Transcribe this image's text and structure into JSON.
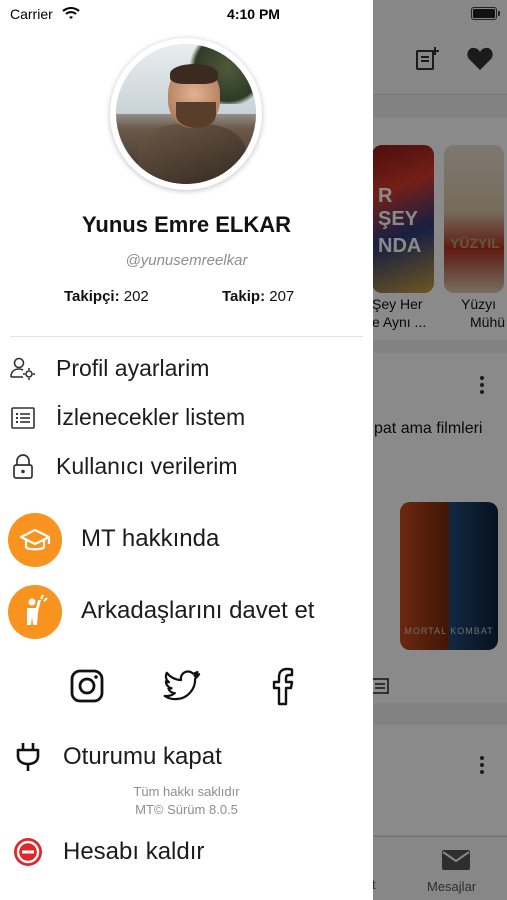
{
  "status_bar": {
    "carrier": "Carrier",
    "time": "4:10 PM"
  },
  "profile": {
    "name": "Yunus Emre ELKAR",
    "handle": "@yunusemreelkar",
    "followers_label": "Takipçi:",
    "followers_count": "202",
    "following_label": "Takip:",
    "following_count": "207"
  },
  "menu": [
    {
      "label": "Profil ayarlarim",
      "icon": "user-settings-icon"
    },
    {
      "label": "İzlenecekler listem",
      "icon": "list-icon"
    },
    {
      "label": "Kullanıcı verilerim",
      "icon": "lock-icon"
    }
  ],
  "highlight_menu": [
    {
      "label": "MT hakkında",
      "icon": "graduation-cap-icon"
    },
    {
      "label": "Arkadaşlarını davet et",
      "icon": "person-waving-icon"
    }
  ],
  "social": [
    "instagram-icon",
    "twitter-icon",
    "facebook-icon"
  ],
  "logout_label": "Oturumu kapat",
  "footer": {
    "rights": "Tüm hakkı saklıdır",
    "version": "MT© Sürüm  8.0.5"
  },
  "delete_account_label": "Hesabı kaldır",
  "background": {
    "poster1_title": "Şey Her",
    "poster1_subtitle": "e Aynı ...",
    "poster2_title": "Yüzyı",
    "poster2_subtitle": "Mühü",
    "section_text": "pat ama filmleri",
    "movie_poster_text": "MORTAL KOMBAT",
    "tab_partial": "t",
    "tab_messages": "Mesajlar"
  },
  "colors": {
    "accent": "#f7931e",
    "delete": "#e0262a"
  }
}
